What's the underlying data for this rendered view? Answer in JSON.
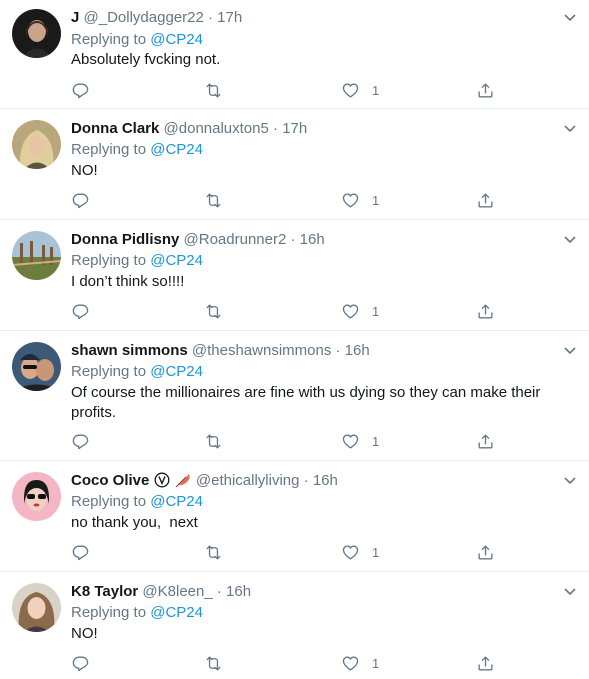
{
  "reply_prefix": "Replying to",
  "reply_target": "@CP24",
  "colors": {
    "link": "#1b95e0",
    "muted": "#657786",
    "text": "#14171a",
    "divider": "#e6ecf0"
  },
  "tweets": [
    {
      "name": "J",
      "handle": "@_Dollydagger22",
      "time": "17h",
      "text": "Absolutely fvcking not.",
      "like_count": "1",
      "avatar_icon": "user-avatar-icon"
    },
    {
      "name": "Donna Clark",
      "handle": "@donnaluxton5",
      "time": "17h",
      "text": "NO!",
      "like_count": "1",
      "avatar_icon": "user-avatar-icon"
    },
    {
      "name": "Donna Pidlisny",
      "handle": "@Roadrunner2",
      "time": "16h",
      "text": "I don’t think so!!!!",
      "like_count": "1",
      "avatar_icon": "user-avatar-icon"
    },
    {
      "name": "shawn simmons",
      "handle": "@theshawnsimmons",
      "time": "16h",
      "text": "Of course the millionaires are fine with us dying so they can make their profits.",
      "like_count": "1",
      "avatar_icon": "user-avatar-icon"
    },
    {
      "name": "Coco Olive",
      "handle": "@ethicallyliving",
      "time": "16h",
      "text": "no thank you,  next",
      "like_count": "1",
      "avatar_icon": "user-avatar-icon",
      "name_emoji": [
        "vegan-v-icon",
        "feather-icon"
      ]
    },
    {
      "name": "K8 Taylor",
      "handle": "@K8leen_",
      "time": "16h",
      "text": "NO!",
      "like_count": "1",
      "avatar_icon": "user-avatar-icon"
    }
  ]
}
